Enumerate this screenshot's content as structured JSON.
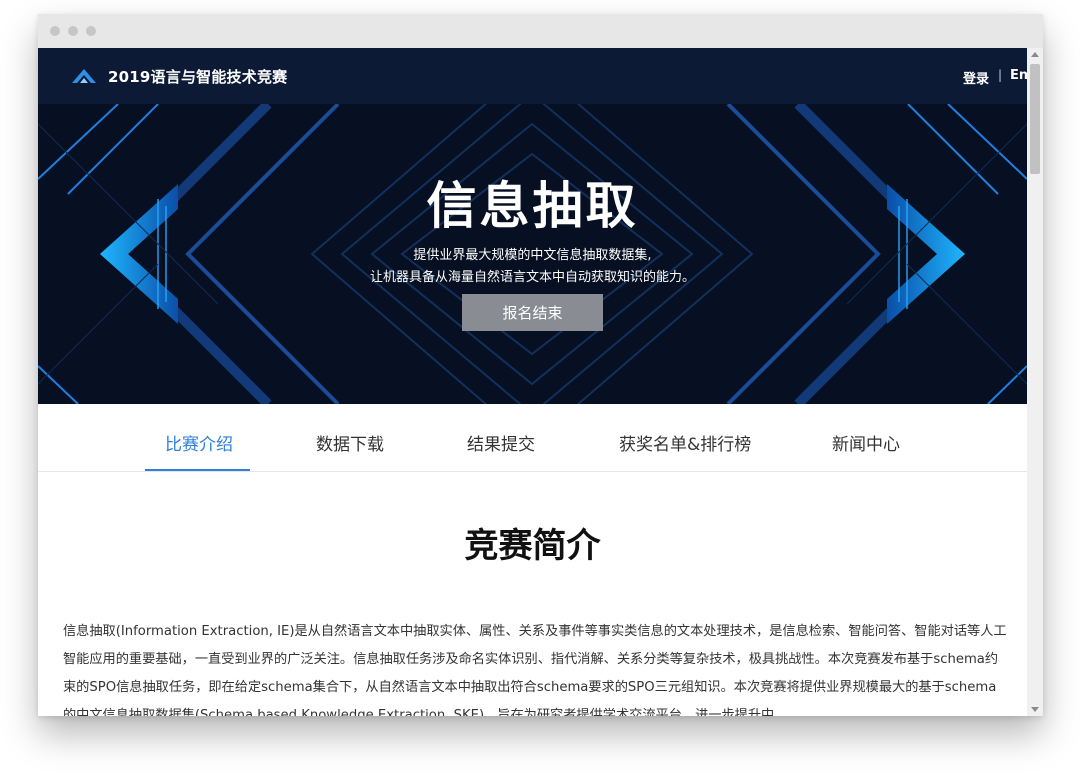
{
  "header": {
    "site_title": "2019语言与智能技术竞赛",
    "login": "登录",
    "separator": "|",
    "lang": "English"
  },
  "hero": {
    "title": "信息抽取",
    "subtitle_line1": "提供业界最大规模的中文信息抽取数据集,",
    "subtitle_line2": "让机器具备从海量自然语言文本中自动获取知识的能力。",
    "button": "报名结束"
  },
  "tabs": [
    "比赛介绍",
    "数据下载",
    "结果提交",
    "获奖名单&排行榜",
    "新闻中心"
  ],
  "active_tab": "比赛介绍",
  "section": {
    "title": "竞赛简介",
    "paragraph": "信息抽取(Information Extraction, IE)是从自然语言文本中抽取实体、属性、关系及事件等事实类信息的文本处理技术，是信息检索、智能问答、智能对话等人工智能应用的重要基础，一直受到业界的广泛关注。信息抽取任务涉及命名实体识别、指代消解、关系分类等复杂技术，极具挑战性。本次竞赛发布基于schema约束的SPO信息抽取任务，即在给定schema集合下，从自然语言文本中抽取出符合schema要求的SPO三元组知识。本次竞赛将提供业界规模最大的基于schema的中文信息抽取数据集(Schema based Knowledge Extraction, SKE)，旨在为研究者提供学术交流平台，进一步提升中"
  },
  "colors": {
    "nav_bg": "#0c1a36",
    "banner_bg": "#071022",
    "accent": "#2f7fdc",
    "button_gray": "#8a8c93"
  }
}
